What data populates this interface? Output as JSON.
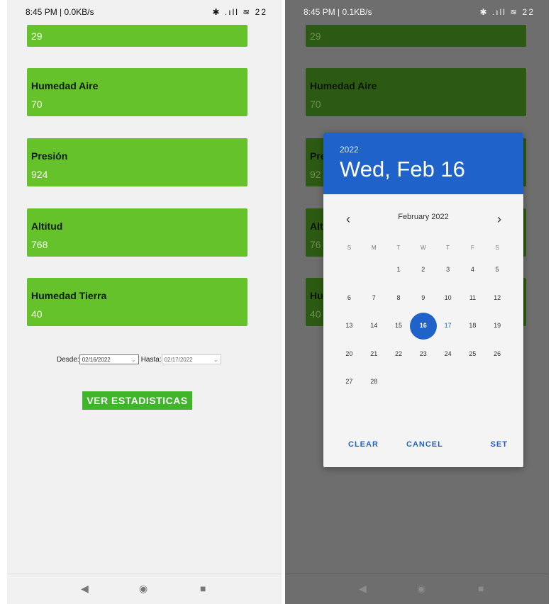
{
  "left_screen": {
    "status": {
      "time": "8:45 PM | 0.0KB/s",
      "icons": "✱ .ıll ≋ 22"
    },
    "cards": [
      {
        "title": "",
        "value": "29"
      },
      {
        "title": "Humedad Aire",
        "value": "70"
      },
      {
        "title": "Presión",
        "value": "924"
      },
      {
        "title": "Altitud",
        "value": "768"
      },
      {
        "title": "Humedad Tierra",
        "value": "40"
      }
    ],
    "desde_label": "Desde:",
    "desde_value": "02/16/2022",
    "hasta_label": "Hasta:",
    "hasta_value": "02/17/2022",
    "button_label": "VER ESTADISTICAS",
    "nav": {
      "back": "◀",
      "home": "◉",
      "recent": "■"
    }
  },
  "right_screen": {
    "status": {
      "time": "8:45 PM | 0.1KB/s",
      "icons": "✱ .ıll ≋ 22"
    },
    "cards": [
      {
        "title": "",
        "value": "29"
      },
      {
        "title": "Humedad Aire",
        "value": "70"
      },
      {
        "title": "Pre",
        "value": "92"
      },
      {
        "title": "Alt",
        "value": "76"
      },
      {
        "title": "Hu",
        "value": "40"
      }
    ],
    "nav": {
      "back": "◀",
      "home": "◉",
      "recent": "■"
    },
    "dialog": {
      "year": "2022",
      "selected_date": "Wed, Feb 16",
      "month_label": "February 2022",
      "prev": "‹",
      "next": "›",
      "weekdays": [
        "S",
        "M",
        "T",
        "W",
        "T",
        "F",
        "S"
      ],
      "weeks": [
        [
          "",
          "",
          "1",
          "2",
          "3",
          "4",
          "5"
        ],
        [
          "6",
          "7",
          "8",
          "9",
          "10",
          "11",
          "12"
        ],
        [
          "13",
          "14",
          "15",
          "16",
          "17",
          "18",
          "19"
        ],
        [
          "20",
          "21",
          "22",
          "23",
          "24",
          "25",
          "26"
        ],
        [
          "27",
          "28",
          "",
          "",
          "",
          "",
          ""
        ]
      ],
      "selected_day": "16",
      "today_day": "17",
      "clear_label": "CLEAR",
      "cancel_label": "CANCEL",
      "set_label": "SET"
    }
  }
}
